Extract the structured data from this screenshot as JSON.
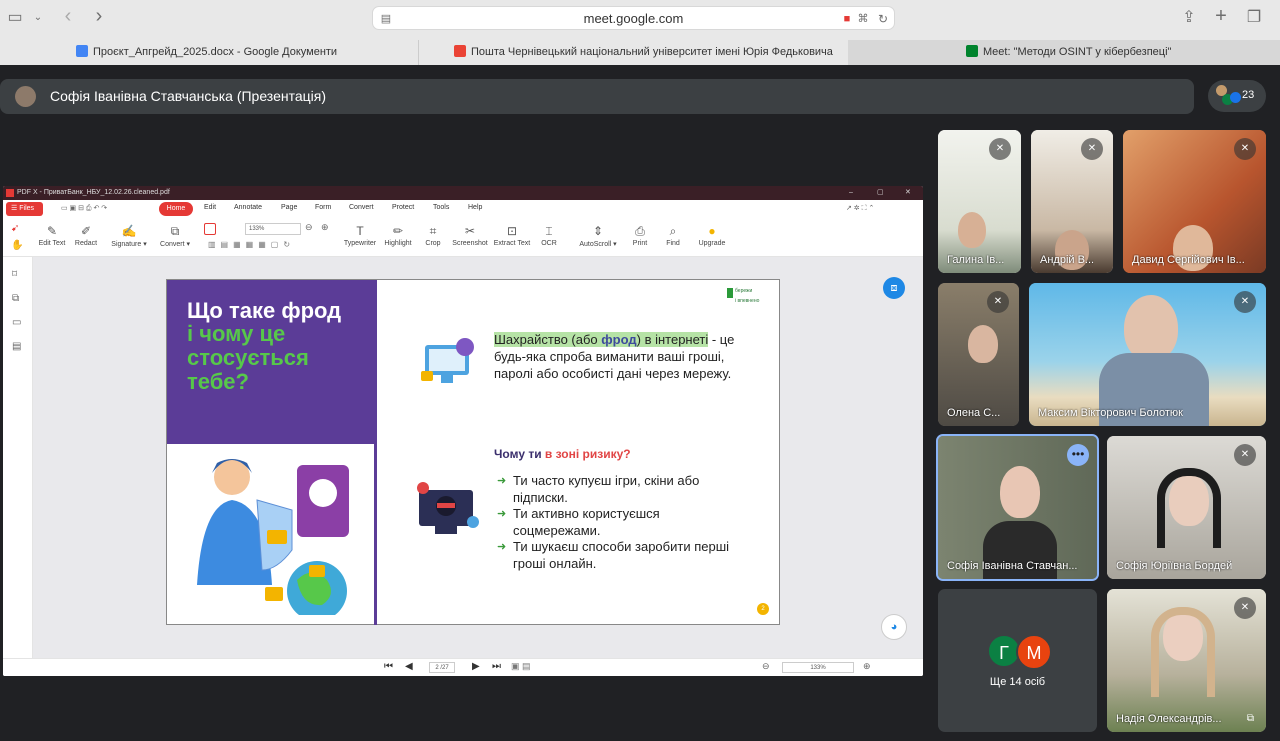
{
  "browser": {
    "url": "meet.google.com",
    "tabs": [
      {
        "label": "Проєкт_Апгрейд_2025.docx - Google Документи"
      },
      {
        "label": "Пошта Чернівецький національний університет імені Юрія Федьковича"
      },
      {
        "label": "Meet: \"Методи OSINT у кібербезпеці\""
      }
    ]
  },
  "meet": {
    "presenter_label": "Софія Іванівна Ставчанська (Презентація)",
    "participant_count": "23",
    "more_people_label": "Ще 14 осіб",
    "more_initials": [
      "Г",
      "М"
    ],
    "participants": [
      {
        "name": "Галина Ів..."
      },
      {
        "name": "Андрій В..."
      },
      {
        "name": "Давид Сергійович Ів..."
      },
      {
        "name": "Олена С..."
      },
      {
        "name": "Максим Вікторович Болотюк"
      },
      {
        "name": "Софія Іванівна Ставчан..."
      },
      {
        "name": "Софія Юріївна Бордей"
      },
      {
        "name": "Надія Олександрів..."
      }
    ]
  },
  "pdf": {
    "window_title": "PDF X - ПриватБанк_НБУ_12.02.26.cleaned.pdf",
    "files_btn": "Files",
    "menu": [
      "Home",
      "Edit",
      "Annotate",
      "Page",
      "Form",
      "Convert",
      "Protect",
      "Tools",
      "Help"
    ],
    "tools": [
      "Edit Text",
      "Redact",
      "Signature ▾",
      "Convert ▾",
      "Typewriter",
      "Highlight",
      "Crop",
      "Screenshot",
      "Extract Text",
      "OCR",
      "AutoScroll ▾",
      "Print",
      "Find",
      "Upgrade"
    ],
    "zoom": "133%",
    "page_indicator": "2 /27",
    "status_zoom": "133%"
  },
  "slide": {
    "title_white": "Що таке фрод",
    "title_green": "і чому це стосується тебе?",
    "logo_text": [
      "бережи",
      "і впевнено"
    ],
    "para_highlight_a": "Шахрайство (або ",
    "para_highlight_b": "фрод",
    "para_highlight_c": ") в інтернеті",
    "para_rest": " - це будь-яка спроба виманити ваші гроші, паролі або особисті дані через мережу.",
    "risk_a": "Чому ти ",
    "risk_b": "в зоні ризику?",
    "bullets": [
      "Ти часто купуєш ігри, скіни або підписки.",
      "Ти активно користуєшся соцмережами.",
      "Ти шукаєш способи заробити перші гроші онлайн."
    ],
    "page_no": "2"
  }
}
